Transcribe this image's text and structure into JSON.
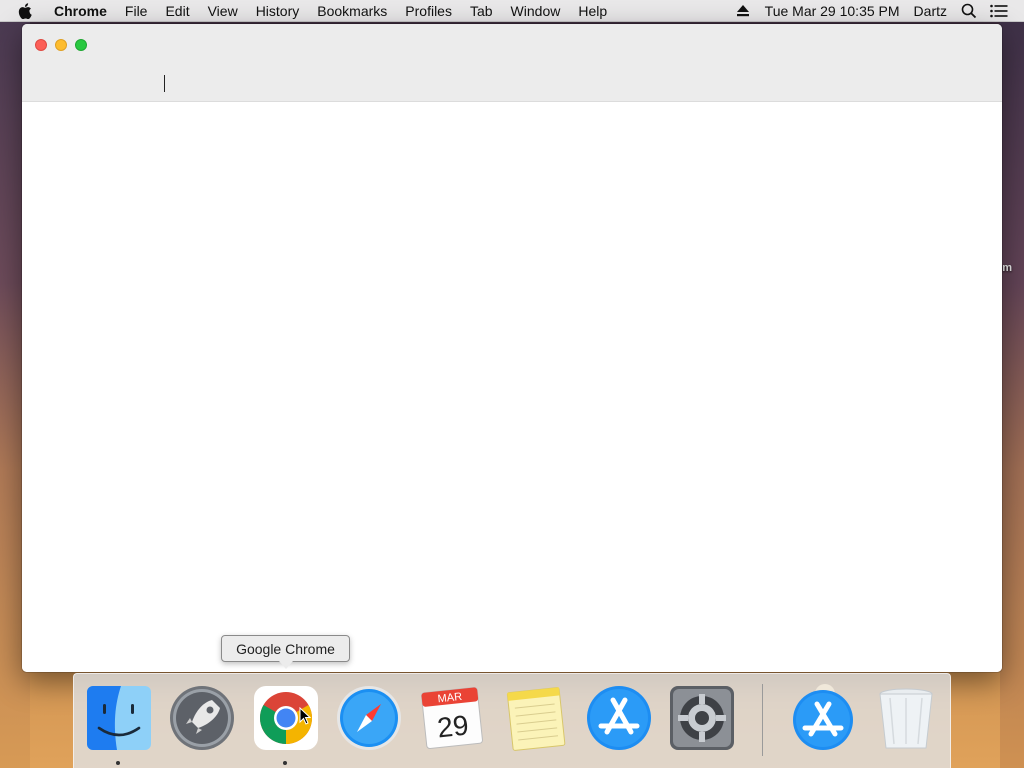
{
  "menubar": {
    "app_name": "Chrome",
    "items": [
      "File",
      "Edit",
      "View",
      "History",
      "Bookmarks",
      "Profiles",
      "Tab",
      "Window",
      "Help"
    ],
    "datetime": "Tue Mar 29  10:35 PM",
    "user": "Dartz",
    "icons": [
      "apple-icon",
      "eject-icon",
      "spotlight-icon",
      "notification-center-icon"
    ]
  },
  "desktop": {
    "label": "m"
  },
  "window": {
    "icons": [
      "close-button",
      "minimize-button",
      "zoom-button"
    ]
  },
  "tooltip": {
    "text": "Google Chrome"
  },
  "dock": {
    "items": [
      {
        "name": "Finder",
        "icon": "finder-icon",
        "running": true
      },
      {
        "name": "Launchpad",
        "icon": "launchpad-icon",
        "running": false
      },
      {
        "name": "Google Chrome",
        "icon": "chrome-icon",
        "running": true
      },
      {
        "name": "Safari",
        "icon": "safari-icon",
        "running": false
      },
      {
        "name": "Calendar",
        "icon": "calendar-icon",
        "running": false
      },
      {
        "name": "Notes",
        "icon": "notes-icon",
        "running": false
      },
      {
        "name": "App Store",
        "icon": "app-store-icon",
        "running": false
      },
      {
        "name": "System Preferences",
        "icon": "system-preferences-icon",
        "running": false
      },
      {
        "name": "App Store Downloads",
        "icon": "downloads-icon",
        "running": false
      },
      {
        "name": "Trash",
        "icon": "trash-icon",
        "running": false
      }
    ],
    "calendar": {
      "month": "MAR",
      "day": "29"
    }
  }
}
